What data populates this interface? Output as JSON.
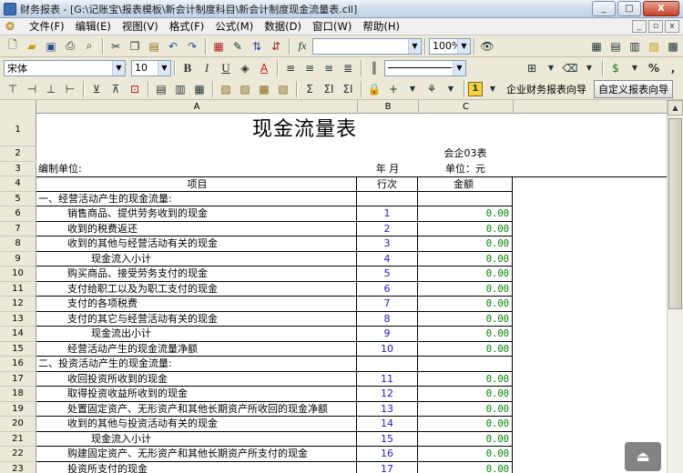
{
  "window": {
    "title": "财务报表 - [G:\\记账宝\\报表模板\\新会计制度科目\\新会计制度现金流量表.cll]",
    "minimize": "_",
    "restore": "□",
    "close": "X"
  },
  "menu": [
    "文件(F)",
    "编辑(E)",
    "视图(V)",
    "格式(F)",
    "公式(M)",
    "数据(D)",
    "窗口(W)",
    "帮助(H)"
  ],
  "mdi": {
    "minimize": "_",
    "restore": "▫",
    "close": "x"
  },
  "toolbar": {
    "formula_label": "fx",
    "zoom": "100%",
    "font_name": "宋体",
    "font_size": "10",
    "bold": "B",
    "italic": "I",
    "underline": "U",
    "percent": "%",
    "thousands": ",",
    "sum1": "Σ",
    "sum2": "ΣΙ",
    "sum3": "ΣΙ",
    "wizard_badge": "1",
    "wizard_button": "企业财务报表向导",
    "custom_wizard_button": "自定义报表向导"
  },
  "sheet": {
    "columns": [
      "A",
      "B",
      "C"
    ],
    "title": "现金流量表",
    "form_code": "会企03表",
    "compiler": "编制单位:",
    "year_month": "年  月",
    "unit": "单位：元",
    "header_item": "项目",
    "header_line": "行次",
    "header_amount": "金额",
    "rows": [
      {
        "n": "5",
        "item": "一、经营活动产生的现金流量:",
        "line": "",
        "amount": "",
        "indent": 0
      },
      {
        "n": "6",
        "item": "销售商品、提供劳务收到的现金",
        "line": "1",
        "amount": "0.00",
        "indent": 1
      },
      {
        "n": "7",
        "item": "收到的税费返还",
        "line": "2",
        "amount": "0.00",
        "indent": 1
      },
      {
        "n": "8",
        "item": "收到的其他与经营活动有关的现金",
        "line": "3",
        "amount": "0.00",
        "indent": 1
      },
      {
        "n": "9",
        "item": "现金流入小计",
        "line": "4",
        "amount": "0.00",
        "indent": 2
      },
      {
        "n": "10",
        "item": "购买商品、接受劳务支付的现金",
        "line": "5",
        "amount": "0.00",
        "indent": 1
      },
      {
        "n": "11",
        "item": "支付给职工以及为职工支付的现金",
        "line": "6",
        "amount": "0.00",
        "indent": 1
      },
      {
        "n": "12",
        "item": "支付的各项税费",
        "line": "7",
        "amount": "0.00",
        "indent": 1
      },
      {
        "n": "13",
        "item": "支付的其它与经营活动有关的现金",
        "line": "8",
        "amount": "0.00",
        "indent": 1
      },
      {
        "n": "14",
        "item": "现金流出小计",
        "line": "9",
        "amount": "0.00",
        "indent": 2
      },
      {
        "n": "15",
        "item": "经营活动产生的现金流量净额",
        "line": "10",
        "amount": "0.00",
        "indent": 1
      },
      {
        "n": "16",
        "item": "二、投资活动产生的现金流量:",
        "line": "",
        "amount": "",
        "indent": 0
      },
      {
        "n": "17",
        "item": "收回投资所收到的现金",
        "line": "11",
        "amount": "0.00",
        "indent": 1
      },
      {
        "n": "18",
        "item": "取得投资收益所收到的现金",
        "line": "12",
        "amount": "0.00",
        "indent": 1
      },
      {
        "n": "19",
        "item": "处置固定资产、无形资产和其他长期资产所收回的现金净额",
        "line": "13",
        "amount": "0.00",
        "indent": 1
      },
      {
        "n": "20",
        "item": "收到的其他与投资活动有关的现金",
        "line": "14",
        "amount": "0.00",
        "indent": 1
      },
      {
        "n": "21",
        "item": "现金流入小计",
        "line": "15",
        "amount": "0.00",
        "indent": 2
      },
      {
        "n": "22",
        "item": "购建固定资产、无形资产和其他长期资产所支付的现金",
        "line": "16",
        "amount": "0.00",
        "indent": 1
      },
      {
        "n": "23",
        "item": "投资所支付的现金",
        "line": "17",
        "amount": "0.00",
        "indent": 1
      }
    ]
  }
}
